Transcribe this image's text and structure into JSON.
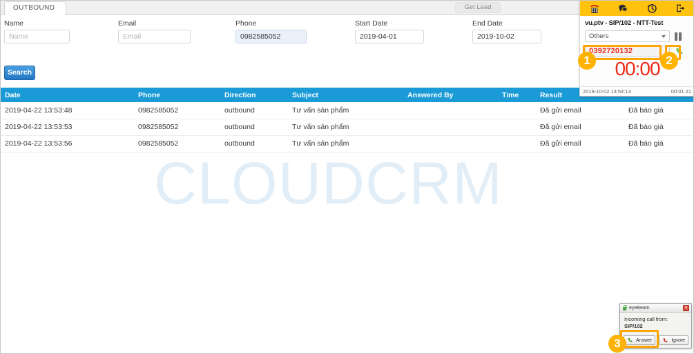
{
  "tabs": {
    "active_tab": "OUTBOUND",
    "get_lead_label": "Get Lead"
  },
  "search_form": {
    "fields": [
      {
        "label": "Name",
        "placeholder": "Name",
        "value": ""
      },
      {
        "label": "Email",
        "placeholder": "Email",
        "value": ""
      },
      {
        "label": "Phone",
        "placeholder": "Phone",
        "value": "0982585052"
      },
      {
        "label": "Start Date",
        "placeholder": "",
        "value": "2019-04-01"
      },
      {
        "label": "End Date",
        "placeholder": "",
        "value": "2019-10-02"
      }
    ],
    "search_label": "Search"
  },
  "table": {
    "headers": [
      "Date",
      "Phone",
      "Direction",
      "Subject",
      "Answered By",
      "Time",
      "Result",
      ""
    ],
    "rows": [
      {
        "date": "2019-04-22 13:53:48",
        "phone": "0982585052",
        "direction": "outbound",
        "subject": "Tư vấn sản phẩm",
        "answered_by": "",
        "time": "",
        "result": "Đã gửi email",
        "extra": "Đã báo giá"
      },
      {
        "date": "2019-04-22 13:53:53",
        "phone": "0982585052",
        "direction": "outbound",
        "subject": "Tư vấn sản phẩm",
        "answered_by": "",
        "time": "",
        "result": "Đã gửi email",
        "extra": "Đã báo giá"
      },
      {
        "date": "2019-04-22 13:53:56",
        "phone": "0982585052",
        "direction": "outbound",
        "subject": "Tư vấn sản phẩm",
        "answered_by": "",
        "time": "",
        "result": "Đã gửi email",
        "extra": "Đã báo giá"
      }
    ]
  },
  "watermark": "CLOUDCRM",
  "softphone": {
    "toolbar_icons": [
      "dialpad-phone-icon",
      "chat-bubble-icon",
      "call-history-icon",
      "logout-icon"
    ],
    "account": "vu.ptv - SIP/102 - NTT-Test",
    "status_select": "Others",
    "caller_number": "0392720132",
    "timer": "00:00",
    "datetime": "2019-10-02 13:54:13",
    "uptime": "00:01:21"
  },
  "eyebeam": {
    "title": "eyeBeam",
    "message": "Incoming call from:",
    "from": "SIP/102",
    "answer_label": "Answer",
    "ignore_label": "Ignore"
  },
  "annotations": {
    "markers": [
      "1",
      "2",
      "3"
    ]
  },
  "colors": {
    "accent_blue": "#1a9ad6",
    "softphone_yellow": "#ffc20e",
    "annotation_orange": "#ffa500",
    "timer_red": "#ee2b18"
  }
}
